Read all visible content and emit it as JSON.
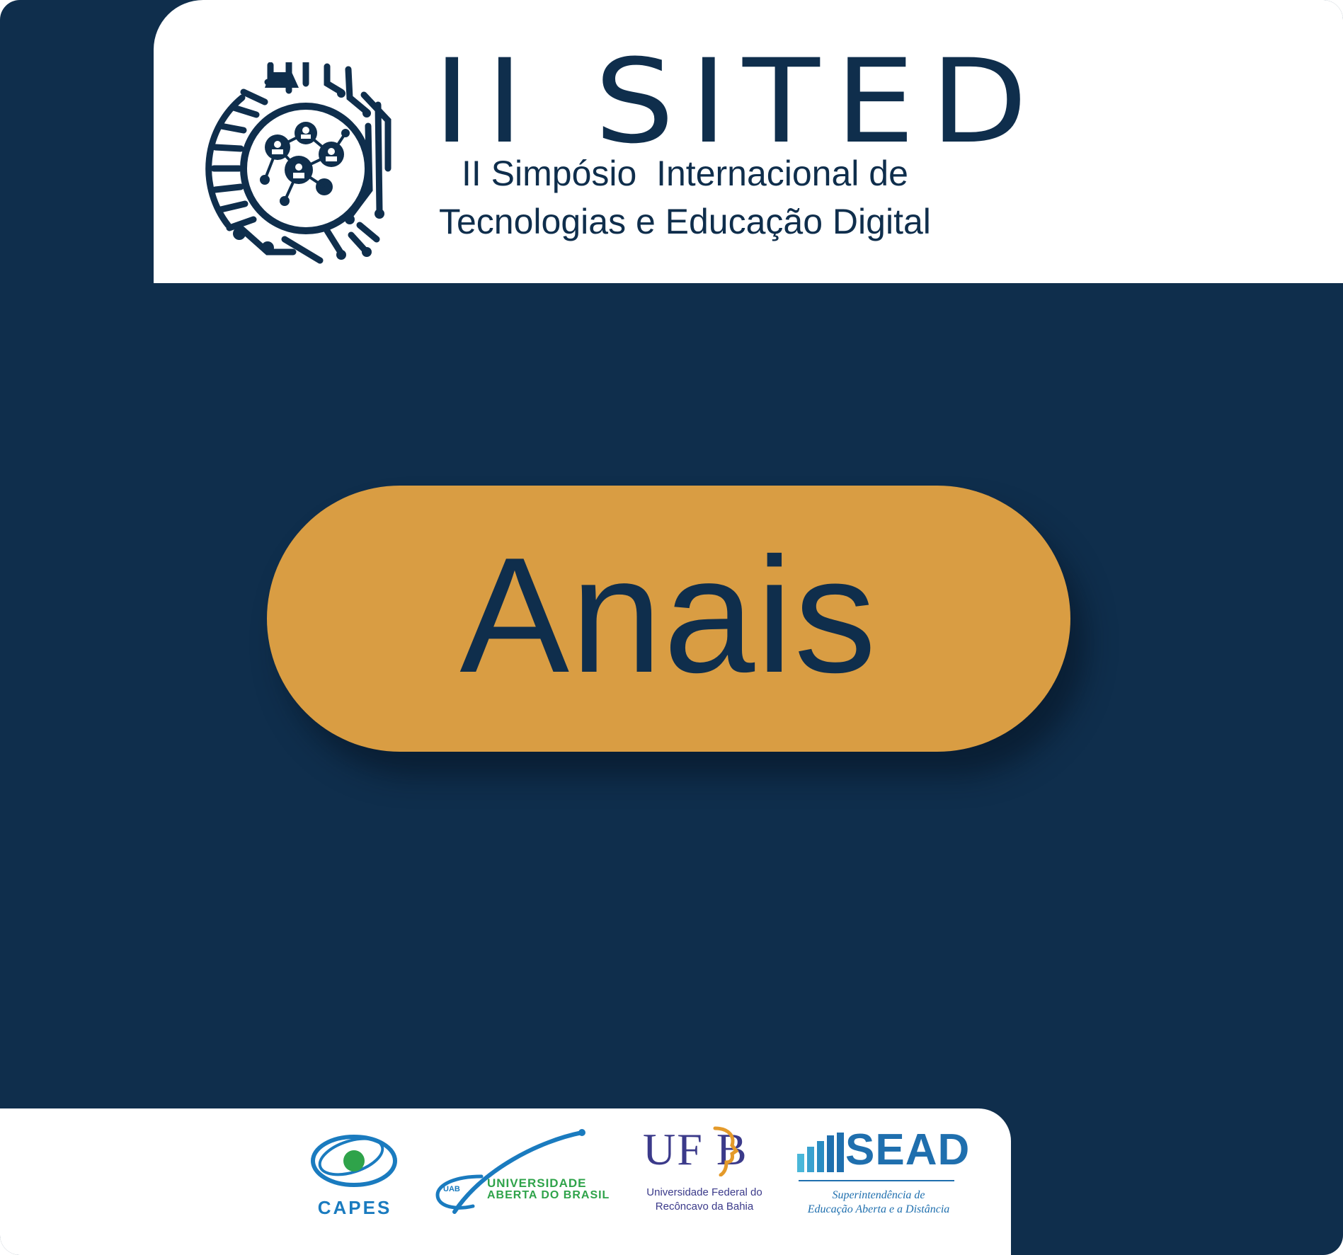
{
  "header": {
    "acronym": "II SITED",
    "name_line1": "II Simpósio  Internacional de",
    "name_line2": "Tecnologias e Educação Digital"
  },
  "main": {
    "button_label": "Anais"
  },
  "sponsors": {
    "capes": {
      "label": "CAPES"
    },
    "uab": {
      "mini": "UAB",
      "line1": "UNIVERSIDADE",
      "line2": "ABERTA DO BRASIL"
    },
    "ufrb": {
      "mark": "UF B",
      "line1": "Universidade Federal do",
      "line2": "Recôncavo da Bahia"
    },
    "sead": {
      "mark": "SEAD",
      "line1": "Superintendência de",
      "line2": "Educação Aberta e a Distância"
    }
  },
  "colors": {
    "navy": "#0f2e4c",
    "gold": "#d99d43",
    "white": "#ffffff",
    "capes_blue": "#1a7bbf",
    "capes_green": "#2fa34a",
    "ufrb_purple": "#3b3a8a",
    "ufrb_orange": "#e49a2a",
    "sead_blue": "#1f6fae"
  },
  "icons": {
    "event_logo": "circuit-globe-icon",
    "sead_bars": "book-bars-icon",
    "ufrb_face": "profile-face-icon"
  }
}
